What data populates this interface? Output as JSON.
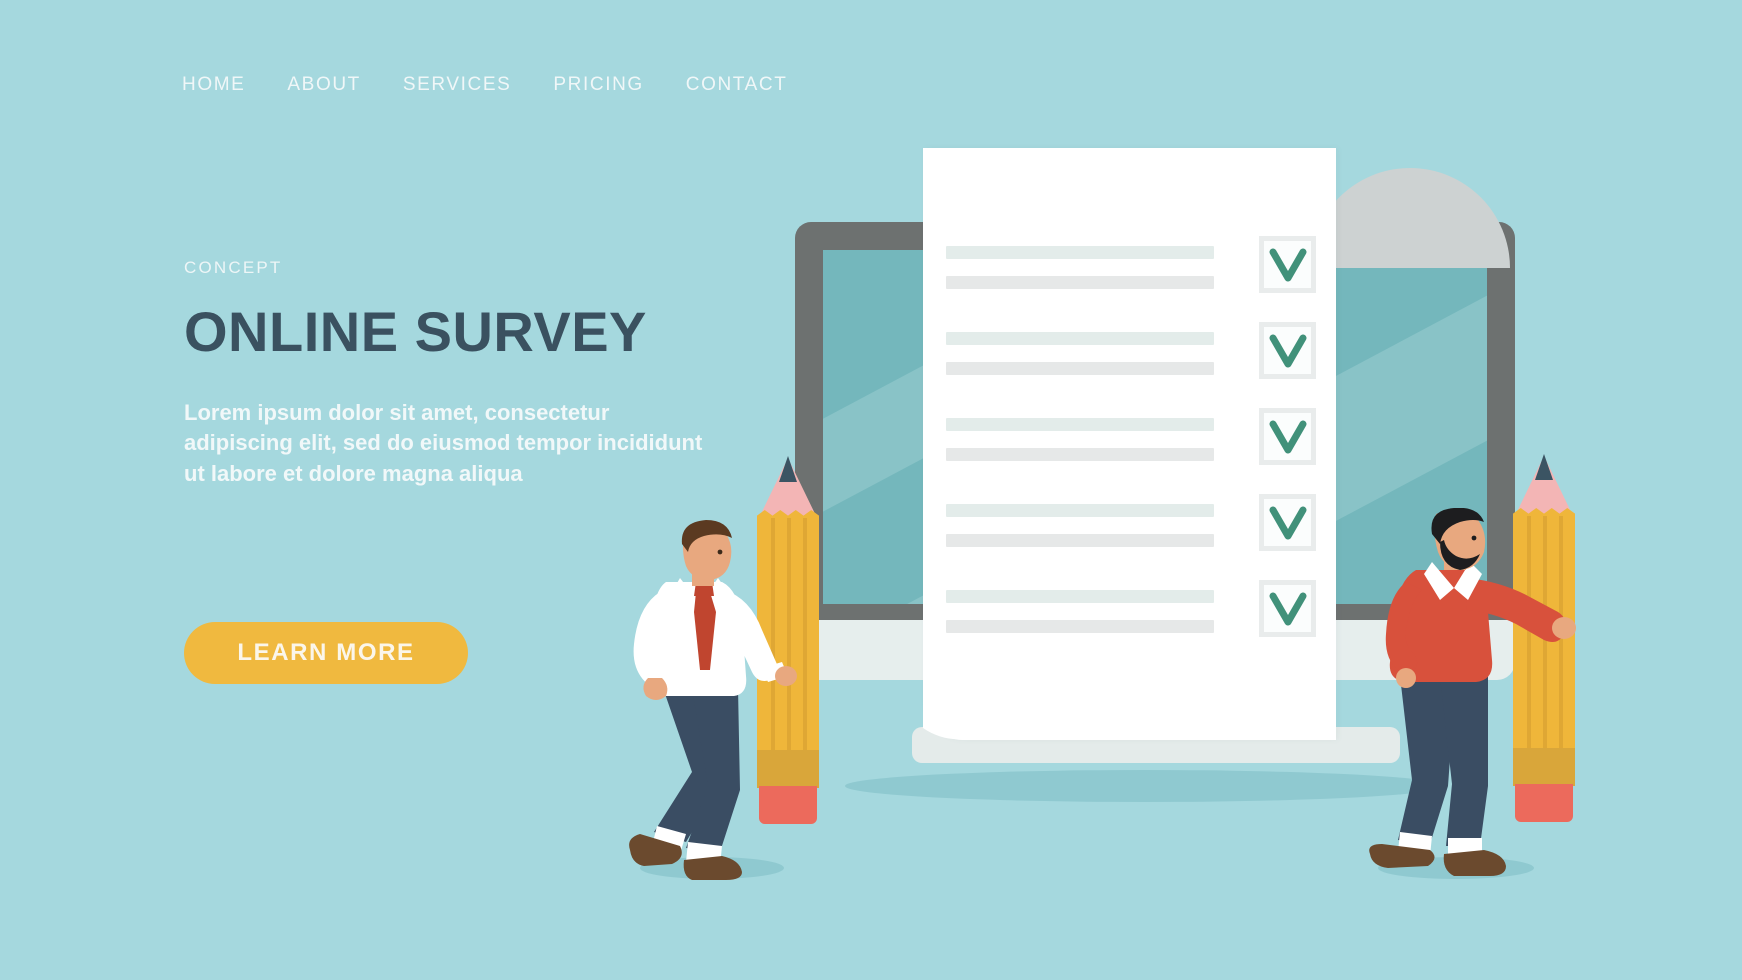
{
  "page": {
    "background_color": "#a5d8de",
    "accent_color": "#f0b93f",
    "heading_color": "#3a5160",
    "check_color": "#41917a"
  },
  "nav": {
    "items": [
      {
        "label": "HOME"
      },
      {
        "label": "ABOUT"
      },
      {
        "label": "SERVICES"
      },
      {
        "label": "PRICING"
      },
      {
        "label": "CONTACT"
      }
    ]
  },
  "hero": {
    "eyebrow": "CONCEPT",
    "headline": "ONLINE SURVEY",
    "lede": "Lorem ipsum dolor sit amet, consectetur adipiscing elit, sed do eiusmod tempor incididunt ut labore et dolore magna aliqua",
    "cta_label": "LEARN MORE"
  },
  "illustration": {
    "monitor": {
      "bezel_color": "#6d7170",
      "screen_color": "#74b7bc",
      "glare_color": "#89c3c7",
      "chin_color": "#e6eeed",
      "base_color": "#e4ebea"
    },
    "document": {
      "background_color": "#ffffff",
      "curl_color": "#cdd2d2",
      "line_color_primary": "#e3ecea",
      "line_color_secondary": "#e6e8e8",
      "checkbox_border_color": "#e9ecec",
      "checklist": [
        {
          "checked": true
        },
        {
          "checked": true
        },
        {
          "checked": true
        },
        {
          "checked": true
        },
        {
          "checked": true
        }
      ]
    },
    "pencils": [
      {
        "side": "left",
        "body_color": "#efb63a",
        "ferrule_color": "#d9a63a",
        "eraser_color": "#ec6a5c",
        "wood_color": "#f3b5b5",
        "graphite_color": "#3b5463"
      },
      {
        "side": "right",
        "body_color": "#efb63a",
        "ferrule_color": "#d9a63a",
        "eraser_color": "#ec6a5c",
        "wood_color": "#f3b5b5",
        "graphite_color": "#3b5463"
      }
    ],
    "people": [
      {
        "side": "left",
        "shirt_color": "#ffffff",
        "tie_color": "#c0452f",
        "pants_color": "#3a4d63",
        "shoe_color": "#6b4a2e",
        "hair_color": "#5b3a21",
        "skin_color": "#e8a87f"
      },
      {
        "side": "right",
        "sweater_color": "#d8513c",
        "pants_color": "#3a4d63",
        "shoe_color": "#6b4a2e",
        "hair_color": "#1d1d1f",
        "skin_color": "#e8a87f"
      }
    ]
  }
}
